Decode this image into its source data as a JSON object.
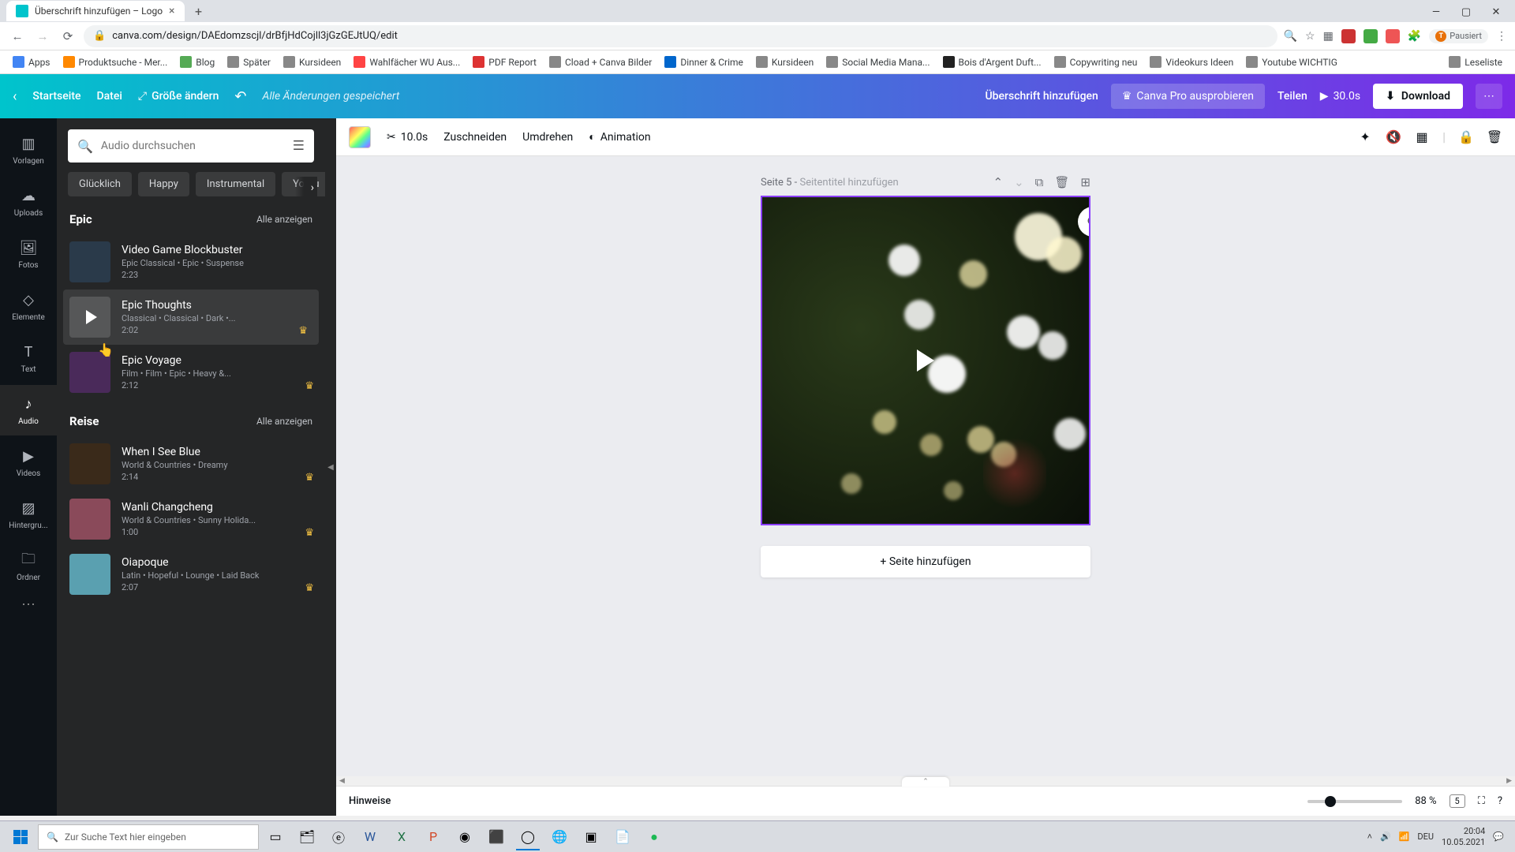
{
  "browser": {
    "tab_title": "Überschrift hinzufügen – Logo",
    "url": "canva.com/design/DAEdomzscjl/drBfjHdCojll3jGzGEJtUQ/edit",
    "pause_label": "Pausiert",
    "bookmarks": [
      "Apps",
      "Produktsuche - Mer...",
      "Blog",
      "Später",
      "Kursideen",
      "Wahlfächer WU Aus...",
      "PDF Report",
      "Cload + Canva Bilder",
      "Dinner & Crime",
      "Kursideen",
      "Social Media Mana...",
      "Bois d'Argent Duft...",
      "Copywriting neu",
      "Videokurs Ideen",
      "Youtube WICHTIG",
      "Leseliste"
    ]
  },
  "header": {
    "home": "Startseite",
    "file": "Datei",
    "resize": "Größe ändern",
    "saved": "Alle Änderungen gespeichert",
    "doc_title": "Überschrift hinzufügen",
    "pro": "Canva Pro ausprobieren",
    "share": "Teilen",
    "duration": "30.0s",
    "download": "Download"
  },
  "rail": {
    "items": [
      "Vorlagen",
      "Uploads",
      "Fotos",
      "Elemente",
      "Text",
      "Audio",
      "Videos",
      "Hintergru...",
      "Ordner"
    ],
    "active_index": 5
  },
  "panel": {
    "search_placeholder": "Audio durchsuchen",
    "chips": [
      "Glücklich",
      "Happy",
      "Instrumental",
      "Youtu"
    ],
    "all_label": "Alle anzeigen",
    "sections": [
      {
        "title": "Epic",
        "tracks": [
          {
            "title": "Video Game Blockbuster",
            "meta": "Epic Classical • Epic • Suspense",
            "dur": "2:23",
            "premium": false,
            "hover": false
          },
          {
            "title": "Epic Thoughts",
            "meta": "Classical • Classical • Dark •...",
            "dur": "2:02",
            "premium": true,
            "hover": true
          },
          {
            "title": "Epic Voyage",
            "meta": "Film • Film • Epic • Heavy &...",
            "dur": "2:12",
            "premium": true,
            "hover": false
          }
        ]
      },
      {
        "title": "Reise",
        "tracks": [
          {
            "title": "When I See Blue",
            "meta": "World & Countries • Dreamy",
            "dur": "2:14",
            "premium": true,
            "hover": false
          },
          {
            "title": "Wanli Changcheng",
            "meta": "World & Countries • Sunny Holida...",
            "dur": "1:00",
            "premium": true,
            "hover": false
          },
          {
            "title": "Oiapoque",
            "meta": "Latin • Hopeful • Lounge • Laid Back",
            "dur": "2:07",
            "premium": true,
            "hover": false
          }
        ]
      }
    ]
  },
  "context": {
    "clip_time": "10.0s",
    "crop": "Zuschneiden",
    "flip": "Umdrehen",
    "animation": "Animation"
  },
  "canvas": {
    "page_label": "Seite 5",
    "page_subtitle": "Seitentitel hinzufügen",
    "add_page": "+ Seite hinzufügen"
  },
  "bottom": {
    "notes": "Hinweise",
    "zoom": "88 %",
    "page_count": "5"
  },
  "taskbar": {
    "search_placeholder": "Zur Suche Text hier eingeben",
    "lang": "DEU",
    "time": "20:04",
    "date": "10.05.2021"
  },
  "thumb_colors": [
    "#2a3a4a",
    "#565758",
    "#4a2a5a",
    "#3a2a1a",
    "#8a4a5a",
    "#5aa0b0"
  ]
}
